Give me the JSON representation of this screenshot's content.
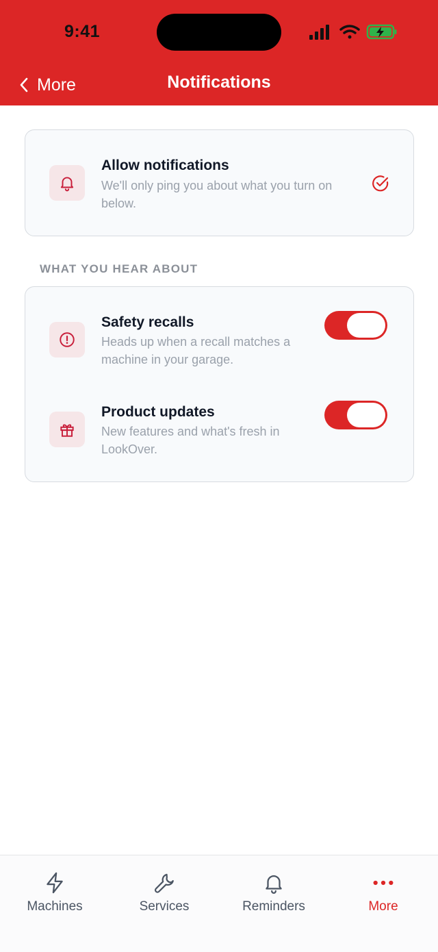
{
  "status_bar": {
    "time": "9:41"
  },
  "nav": {
    "back_label": "More",
    "title": "Notifications"
  },
  "allow_card": {
    "title": "Allow notifications",
    "description": "We'll only ping you about what you turn on below."
  },
  "section": {
    "label": "WHAT YOU HEAR ABOUT"
  },
  "rows": [
    {
      "title": "Safety recalls",
      "description": "Heads up when a recall matches a machine in your garage.",
      "enabled": true
    },
    {
      "title": "Product updates",
      "description": "New features and what's fresh in LookOver.",
      "enabled": true
    }
  ],
  "tabs": [
    {
      "label": "Machines",
      "icon": "bolt-icon"
    },
    {
      "label": "Services",
      "icon": "wrench-icon"
    },
    {
      "label": "Reminders",
      "icon": "bell-icon"
    },
    {
      "label": "More",
      "icon": "more-dots-icon",
      "active": true
    }
  ],
  "colors": {
    "accent": "#dc2626",
    "muted_text": "#9aa1ab",
    "icon_bg": "#f6e6e8"
  }
}
